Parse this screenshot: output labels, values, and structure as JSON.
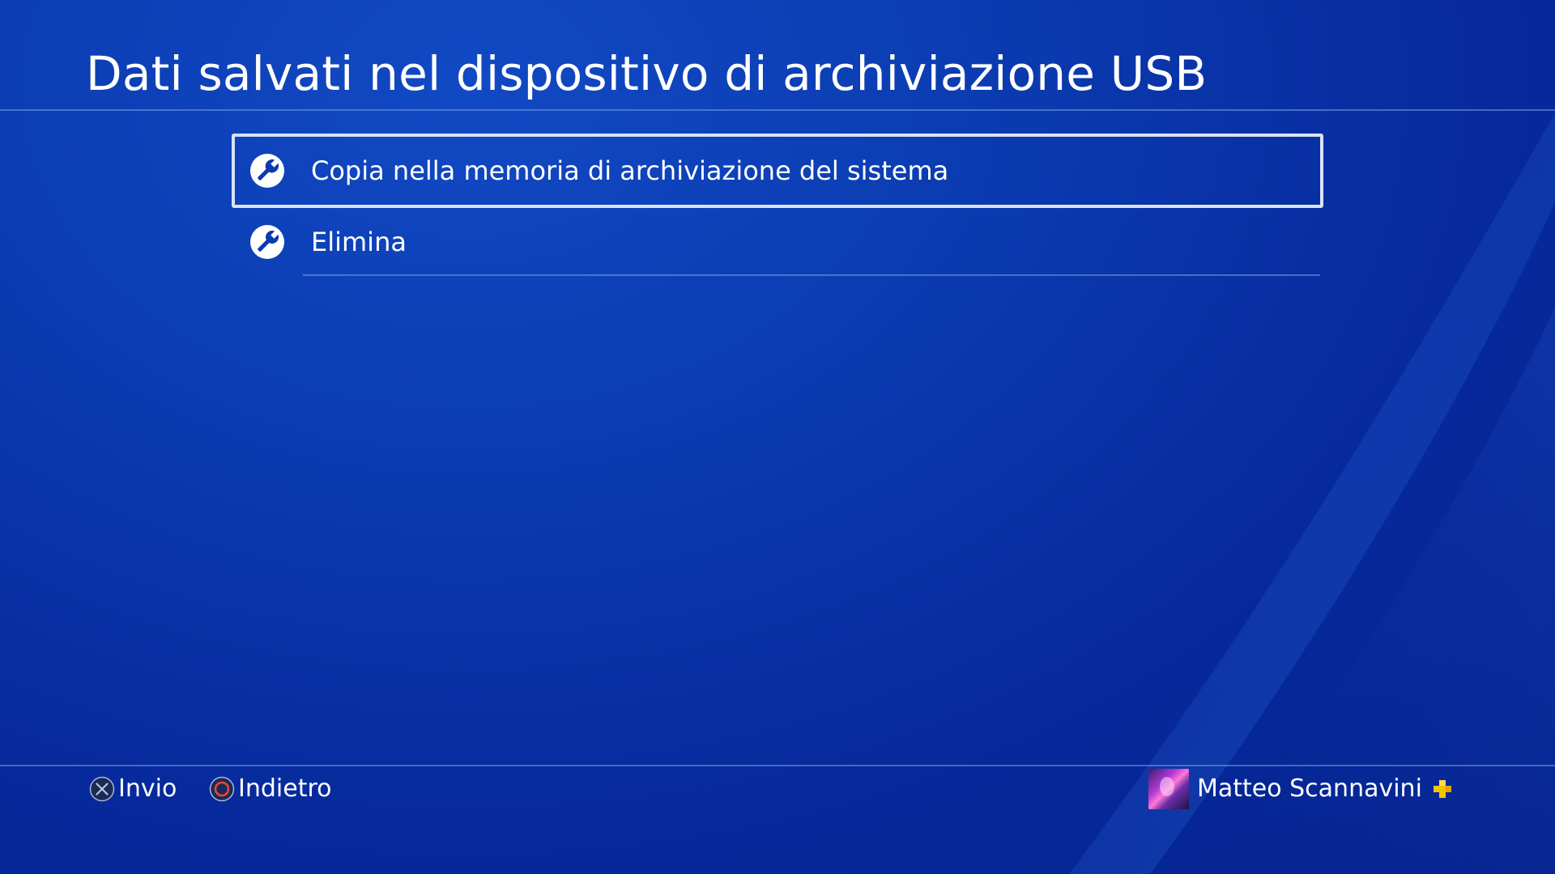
{
  "header": {
    "title": "Dati salvati nel dispositivo di archiviazione USB"
  },
  "menu": {
    "items": [
      {
        "label": "Copia nella memoria di archiviazione del sistema",
        "icon": "wrench-icon",
        "selected": true
      },
      {
        "label": "Elimina",
        "icon": "wrench-icon",
        "selected": false
      }
    ]
  },
  "footer": {
    "hints": [
      {
        "button": "cross-button-icon",
        "label": "Invio"
      },
      {
        "button": "circle-button-icon",
        "label": "Indietro"
      }
    ],
    "user": {
      "name": "Matteo Scannavini",
      "badge": "playstation-plus-icon"
    }
  },
  "colors": {
    "background": "#0a35a8",
    "selection_border": "#d9e2f6",
    "plus_badge": "#f5c400",
    "circle_button": "#e8453c"
  }
}
